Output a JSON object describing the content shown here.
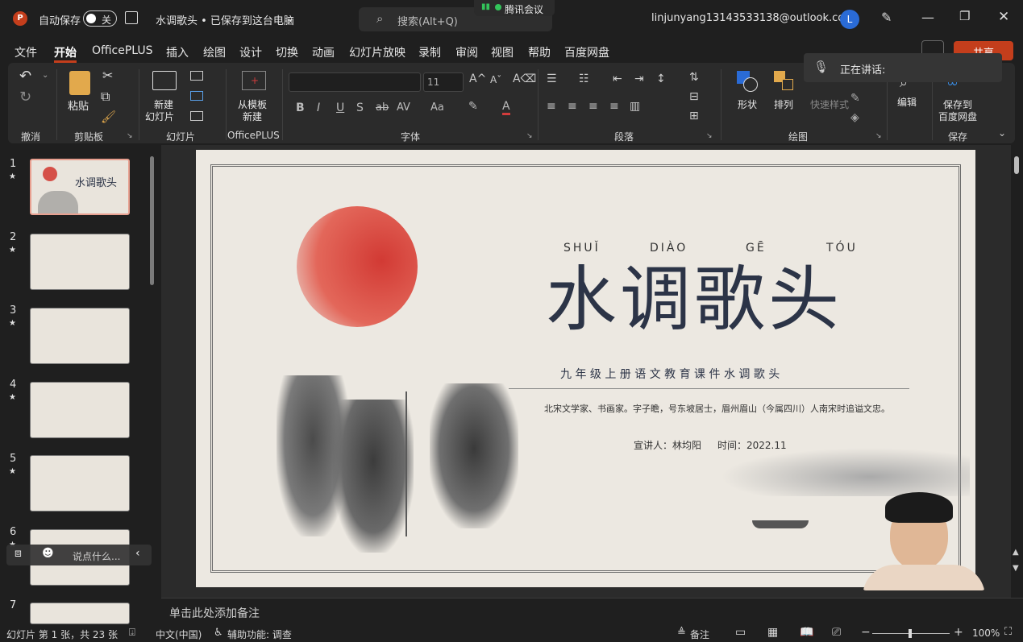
{
  "titlebar": {
    "autosave_label": "自动保存",
    "autosave_state": "关",
    "doc_title": "水调歌头 • 已保存到这台电脑",
    "search_placeholder": "搜索(Alt+Q)",
    "meeting_label": "腾讯会议",
    "account": "linjunyang13143533138@outlook.com",
    "avatar_letter": "L"
  },
  "tabs": [
    "文件",
    "开始",
    "OfficePLUS",
    "插入",
    "绘图",
    "设计",
    "切换",
    "动画",
    "幻灯片放映",
    "录制",
    "审阅",
    "视图",
    "帮助",
    "百度网盘"
  ],
  "share_label": "共享",
  "speaking_label": "正在讲话:",
  "ribbon": {
    "groups": {
      "undo": "撤消",
      "clipboard": "剪贴板",
      "slides": "幻灯片",
      "officeplus": "OfficePLUS",
      "font": "字体",
      "paragraph": "段落",
      "drawing": "绘图",
      "save": "保存"
    },
    "paste": "粘贴",
    "new_slide_1": "新建",
    "new_slide_2": "幻灯片",
    "from_template_1": "从模板",
    "from_template_2": "新建",
    "font_size": "11",
    "shape": "形状",
    "arrange": "排列",
    "quick_style": "快速样式",
    "edit": "编辑",
    "save_baidu_1": "保存到",
    "save_baidu_2": "百度网盘"
  },
  "thumbnails": [
    "1",
    "2",
    "3",
    "4",
    "5",
    "6",
    "7"
  ],
  "thumb1_title": "水调歌头",
  "chat_placeholder": "说点什么...",
  "slide": {
    "pinyin": [
      "SHUǏ",
      "DIÀO",
      "GĒ",
      "TÓU"
    ],
    "title": "水调歌头",
    "subtitle": "九 年 级 上 册 语 文 教 育 课 件 水 调 歌 头",
    "description": "北宋文学家、书画家。字子瞻，号东坡居士，眉州眉山（今属四川）人南宋时追谥文忠。",
    "presenter": "宣讲人：林均阳",
    "date": "时间：2022.11"
  },
  "notes_placeholder": "单击此处添加备注",
  "statusbar": {
    "slide_info": "幻灯片 第 1 张，共 23 张",
    "language": "中文(中国)",
    "accessibility": "辅助功能: 调查",
    "notes": "备注",
    "zoom": "100%"
  },
  "colors": {
    "accent_red": "#c43e1c",
    "slide_title": "#2c3447",
    "selected_thumb": "#e8a090"
  }
}
